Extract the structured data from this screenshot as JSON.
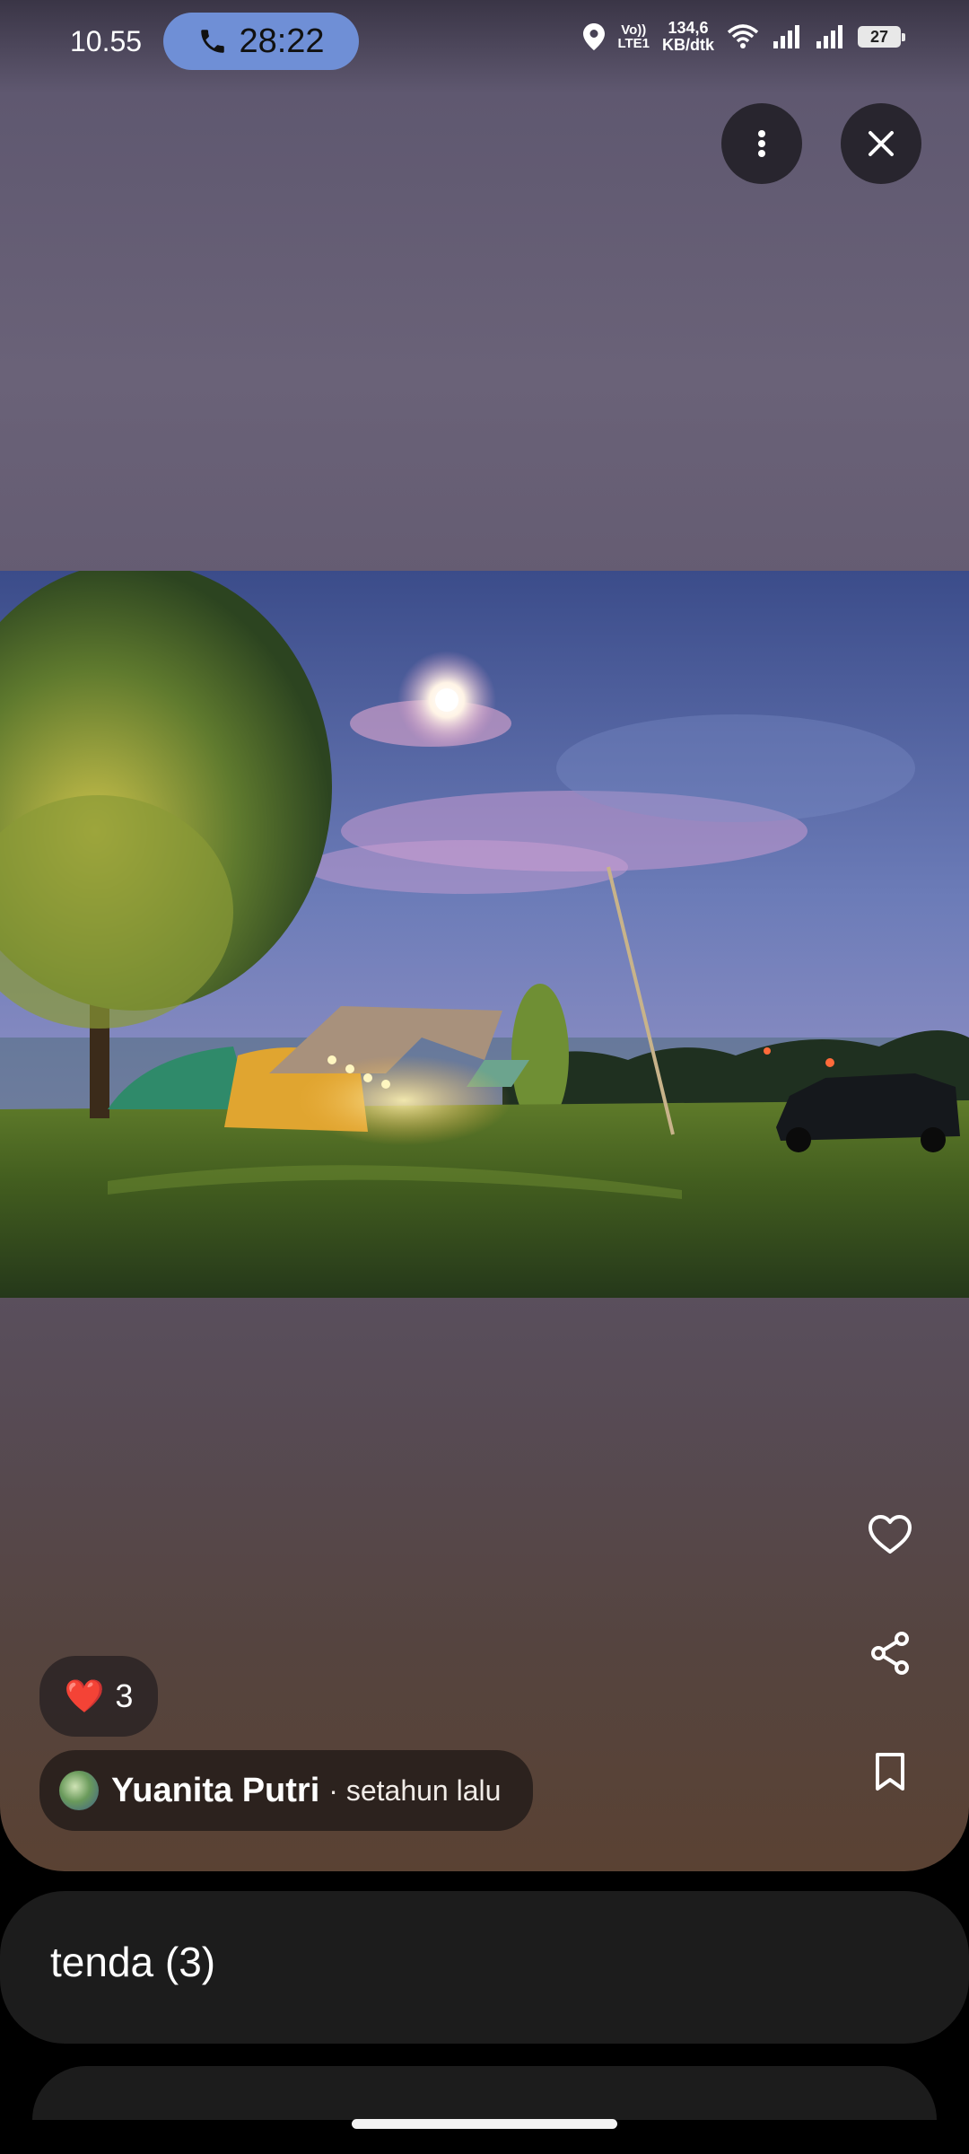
{
  "status_bar": {
    "time": "10.55",
    "call_timer": "28:22",
    "volte_top": "Vo))",
    "volte_bottom": "LTE1",
    "speed_top": "134,6",
    "speed_bottom": "KB/dtk",
    "battery": "27"
  },
  "viewer": {
    "more_icon": "more-vertical-icon",
    "close_icon": "close-icon",
    "like_icon": "heart-outline-icon",
    "share_icon": "share-icon",
    "bookmark_icon": "bookmark-icon"
  },
  "reactions": {
    "emoji": "❤️",
    "count": "3"
  },
  "author": {
    "name": "Yuanita Putri",
    "time": "· setahun lalu"
  },
  "album": {
    "title": "tenda (3)"
  }
}
